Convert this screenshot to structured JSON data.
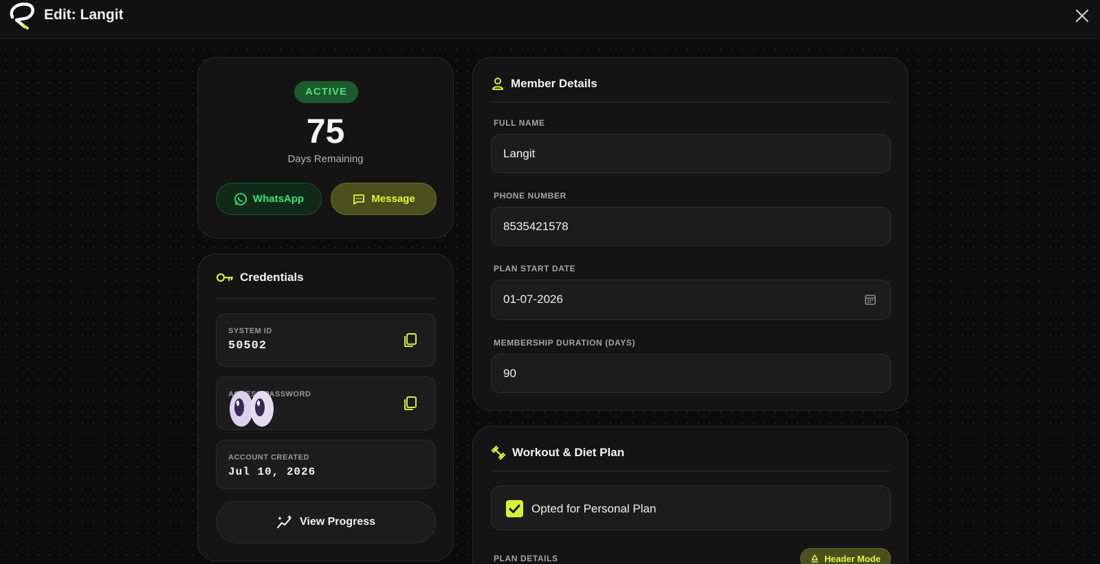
{
  "header": {
    "title": "Edit: Langit",
    "logo_icon": "brand-logo-icon",
    "close_icon": "close-icon"
  },
  "status": {
    "badge": "ACTIVE",
    "days_remaining": "75",
    "days_label": "Days Remaining",
    "whatsapp_label": "WhatsApp",
    "message_label": "Message"
  },
  "credentials": {
    "title": "Credentials",
    "system_id_label": "SYSTEM ID",
    "system_id_value": "50502",
    "password_label": "ACCESS PASSWORD",
    "created_label": "ACCOUNT CREATED",
    "created_value": "Jul 10, 2026",
    "progress_label": "View Progress"
  },
  "member": {
    "title": "Member Details",
    "full_name_label": "FULL NAME",
    "full_name_value": "Langit",
    "phone_label": "PHONE NUMBER",
    "phone_value": "8535421578",
    "start_label": "PLAN START DATE",
    "start_value": "01-07-2026",
    "duration_label": "MEMBERSHIP DURATION (DAYS)",
    "duration_value": "90"
  },
  "workout": {
    "title": "Workout & Diet Plan",
    "opted_label": "Opted for Personal Plan",
    "opted_checked": true,
    "plan_details_label": "PLAN DETAILS",
    "header_mode_label": "Header Mode"
  },
  "colors": {
    "accent": "#d7f03a",
    "whatsapp_green": "#3ee27a",
    "active_green": "#4ee07a",
    "background": "#0b0b0b",
    "card": "#141414"
  }
}
